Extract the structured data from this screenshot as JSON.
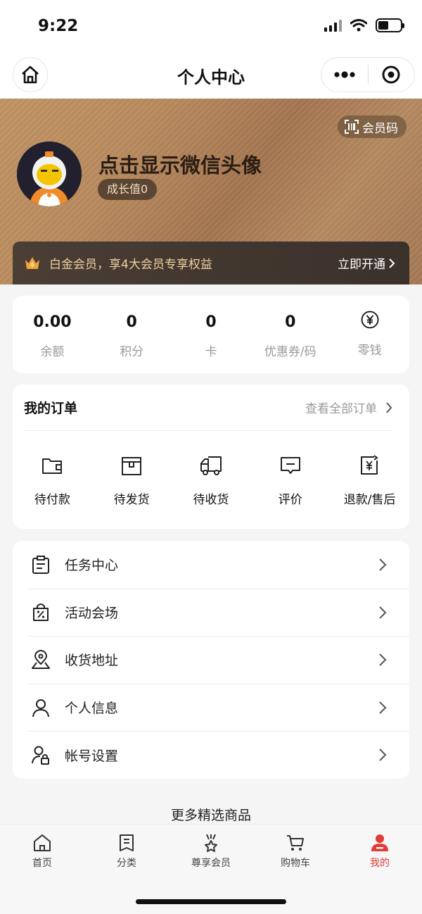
{
  "status_bar": {
    "time": "9:22"
  },
  "nav": {
    "title": "个人中心"
  },
  "profile": {
    "member_code_label": "会员码",
    "name": "点击显示微信头像",
    "growth_label": "成长值0"
  },
  "vip_banner": {
    "text": "白金会员，享4大会员专享权益",
    "action": "立即开通"
  },
  "stats": [
    {
      "value": "0.00",
      "label": "余额"
    },
    {
      "value": "0",
      "label": "积分"
    },
    {
      "value": "0",
      "label": "卡"
    },
    {
      "value": "0",
      "label": "优惠券/码"
    },
    {
      "icon": "yen-circle-icon",
      "label": "零钱"
    }
  ],
  "orders": {
    "title": "我的订单",
    "view_all": "查看全部订单",
    "items": [
      {
        "label": "待付款",
        "icon": "wallet-icon"
      },
      {
        "label": "待发货",
        "icon": "package-icon"
      },
      {
        "label": "待收货",
        "icon": "truck-icon"
      },
      {
        "label": "评价",
        "icon": "comment-icon"
      },
      {
        "label": "退款/售后",
        "icon": "refund-icon"
      }
    ]
  },
  "menu": [
    {
      "label": "任务中心",
      "icon": "clipboard-icon"
    },
    {
      "label": "活动会场",
      "icon": "discount-bag-icon"
    },
    {
      "label": "收货地址",
      "icon": "location-map-icon"
    },
    {
      "label": "个人信息",
      "icon": "user-icon"
    },
    {
      "label": "帐号设置",
      "icon": "user-lock-icon"
    }
  ],
  "more_products": "更多精选商品",
  "tabs": [
    {
      "label": "首页",
      "icon": "home-icon",
      "active": false
    },
    {
      "label": "分类",
      "icon": "category-icon",
      "active": false
    },
    {
      "label": "尊享会员",
      "icon": "member-star-icon",
      "active": false
    },
    {
      "label": "购物车",
      "icon": "cart-icon",
      "active": false
    },
    {
      "label": "我的",
      "icon": "profile-icon",
      "active": true
    }
  ],
  "colors": {
    "accent": "#e33b37",
    "vip_gold": "#f2cf9c",
    "header_brown": "#b58a61"
  }
}
